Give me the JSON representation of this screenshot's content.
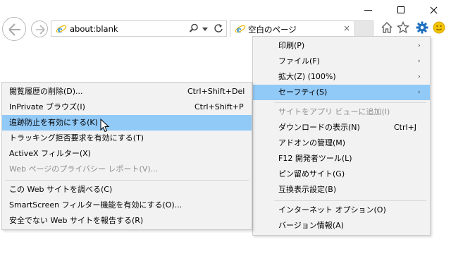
{
  "window": {
    "minimize_icon": "minimize-icon",
    "maximize_icon": "maximize-icon",
    "close_icon": "close-icon"
  },
  "nav": {
    "back_icon": "back-arrow-icon",
    "forward_icon": "forward-arrow-icon"
  },
  "address": {
    "url": "about:blank",
    "search_icon": "search-icon",
    "dropdown_icon": "chevron-down-icon",
    "refresh_icon": "refresh-icon"
  },
  "tab": {
    "title": "空白のページ",
    "close": "×"
  },
  "toolbar": {
    "home_icon": "home-icon",
    "favorites_icon": "star-icon",
    "tools_icon": "gear-icon",
    "feedback_icon": "smiley-icon"
  },
  "tools_menu": {
    "items": [
      {
        "label": "印刷(P)",
        "arrow": "›"
      },
      {
        "label": "ファイル(F)",
        "arrow": "›"
      },
      {
        "label": "拡大(Z) (100%)",
        "arrow": "›"
      },
      {
        "label": "セーフティ(S)",
        "arrow": "›"
      },
      {
        "label": "サイトをアプリ ビューに追加(I)"
      },
      {
        "label": "ダウンロードの表示(N)",
        "shortcut": "Ctrl+J"
      },
      {
        "label": "アドオンの管理(M)"
      },
      {
        "label": "F12 開発者ツール(L)"
      },
      {
        "label": "ピン留めサイト(G)"
      },
      {
        "label": "互換表示設定(B)"
      },
      {
        "label": "インターネット オプション(O)"
      },
      {
        "label": "バージョン情報(A)"
      }
    ]
  },
  "safety_menu": {
    "items": [
      {
        "label": "閲覧履歴の削除(D)...",
        "shortcut": "Ctrl+Shift+Del"
      },
      {
        "label": "InPrivate ブラウズ(I)",
        "shortcut": "Ctrl+Shift+P"
      },
      {
        "label": "追跡防止を有効にする(K)"
      },
      {
        "label": "トラッキング拒否要求を有効にする(T)"
      },
      {
        "label": "ActiveX フィルター(X)"
      },
      {
        "label": "Web ページのプライバシー レポート(V)..."
      },
      {
        "label": "この Web サイトを調べる(C)"
      },
      {
        "label": "SmartScreen フィルター機能を有効にする(O)..."
      },
      {
        "label": "安全でない Web サイトを報告する(R)"
      }
    ]
  },
  "colors": {
    "highlight": "#91c9f7",
    "menu_bg": "#f2f2f2",
    "accent_blue": "#1e6fbf",
    "ie_blue": "#1a8ad4",
    "smiley_yellow": "#f5c400"
  }
}
